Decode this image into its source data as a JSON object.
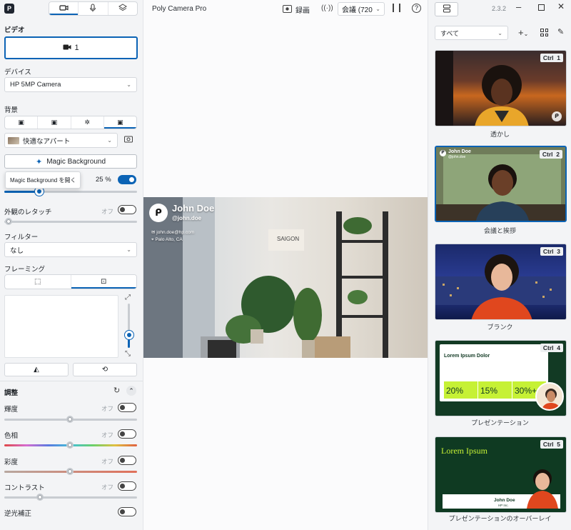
{
  "app": {
    "title": "Poly Camera Pro",
    "logo_glyph": "P",
    "version": "2.3.2"
  },
  "left_tabs": [
    {
      "icon": "video-icon",
      "active": true
    },
    {
      "icon": "microphone-icon",
      "active": false
    },
    {
      "icon": "layers-icon",
      "active": false
    }
  ],
  "video": {
    "section_label": "ビデオ",
    "camera_number": "1"
  },
  "device": {
    "label": "デバイス",
    "value": "HP 5MP Camera"
  },
  "background": {
    "label": "背景",
    "preset": "快適なアパート",
    "magic_button": "Magic Background",
    "tooltip": "Magic Background を開く",
    "blur_percent": "25 %",
    "blur_on": true,
    "blur_level": 0.25
  },
  "touchup": {
    "label": "外観のレタッチ",
    "state": "オフ"
  },
  "filter": {
    "label": "フィルター",
    "value": "なし"
  },
  "framing": {
    "label": "フレーミング"
  },
  "adjust": {
    "label": "調整",
    "items": [
      {
        "name": "輝度",
        "state": "オフ"
      },
      {
        "name": "色相",
        "state": "オフ"
      },
      {
        "name": "彩度",
        "state": "オフ"
      },
      {
        "name": "コントラスト",
        "state": "オフ"
      },
      {
        "name": "逆光補正",
        "state": ""
      }
    ]
  },
  "toolbar": {
    "record": "録画",
    "meeting": "会議 (720"
  },
  "preview": {
    "name": "John Doe",
    "handle": "@john.doe",
    "email": "john.doe@hp.com",
    "location": "Palo Alto, CA",
    "sign": "SAIGON"
  },
  "right": {
    "filter": "すべて"
  },
  "scenes": [
    {
      "label": "透かし",
      "ctrl": "Ctrl",
      "num": "1"
    },
    {
      "label": "会議と挨拶",
      "ctrl": "Ctrl",
      "num": "2",
      "mini_name": "John Doe",
      "mini_handle": "@john.doe"
    },
    {
      "label": "ブランク",
      "ctrl": "Ctrl",
      "num": "3"
    },
    {
      "label": "プレゼンテーション",
      "ctrl": "Ctrl",
      "num": "4",
      "slide_title": "Lorem Ipsum Dolor",
      "stats": [
        "20%",
        "15%",
        "30%+"
      ]
    },
    {
      "label": "プレゼンテーションのオーバーレイ",
      "ctrl": "Ctrl",
      "num": "5",
      "slide_title": "Lorem Ipsum",
      "mini_name": "John Doe",
      "mini_sub": "HP Inc."
    }
  ],
  "colors": {
    "accent": "#0b63b5",
    "lime": "#c6f135"
  }
}
